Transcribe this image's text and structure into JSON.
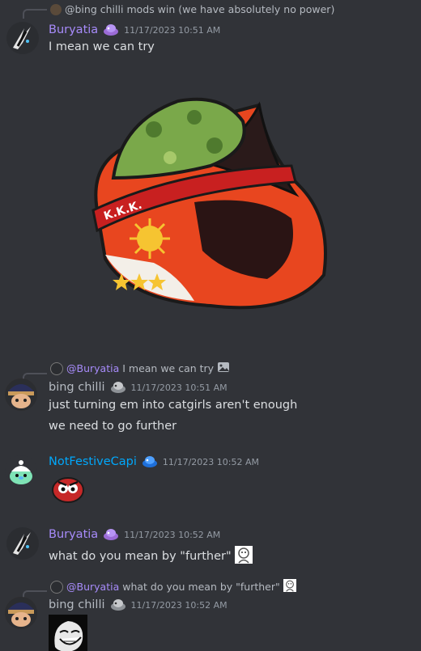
{
  "messages": [
    {
      "reply": {
        "mention": "@bing chilli",
        "text": "mods win (we have absolutely no power)"
      },
      "author": "Buryatia",
      "timestamp": "11/17/2023 10:51 AM",
      "lines": [
        "I mean we can try"
      ]
    },
    {
      "reply": {
        "mention": "@Buryatia",
        "text": "I mean we can try"
      },
      "author": "bing chilli",
      "timestamp": "11/17/2023 10:51 AM",
      "lines": [
        "just turning em into catgirls aren't enough",
        "we need to go further"
      ]
    },
    {
      "author": "NotFestiveCapi",
      "timestamp": "11/17/2023 10:52 AM",
      "lines": []
    },
    {
      "author": "Buryatia",
      "timestamp": "11/17/2023 10:52 AM",
      "lines": [
        "what do you mean by \"further\""
      ]
    },
    {
      "reply": {
        "mention": "@Buryatia",
        "text": "what do you mean by \"further\""
      },
      "author": "bing chilli",
      "timestamp": "11/17/2023 10:52 AM",
      "lines": []
    }
  ],
  "sticker_text": "K.K.K.",
  "colors": {
    "background": "#313338",
    "buryatia": "#a78bfa",
    "bing_chilli": "#b5bac1",
    "notfestivecapi": "#00a8fc"
  }
}
